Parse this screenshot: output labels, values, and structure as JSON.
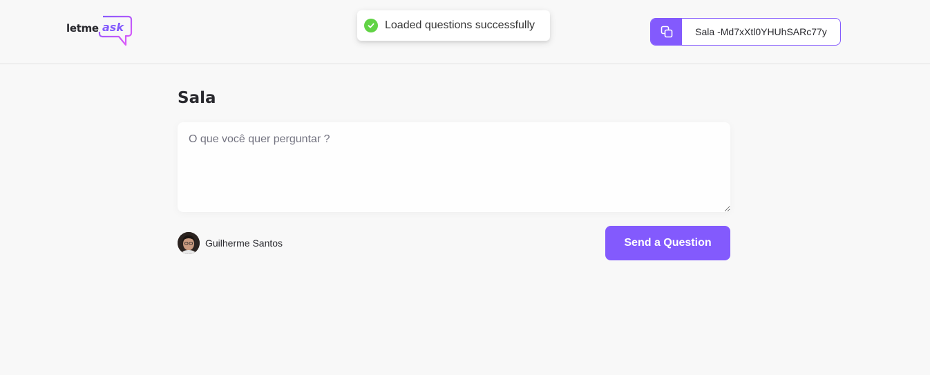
{
  "header": {
    "logo": {
      "text_letme": "letme",
      "text_ask": "ask",
      "icon": "speech-bubble-logo"
    },
    "room_code": {
      "icon": "copy-icon",
      "label": "Sala -Md7xXtl0YHUhSARc77y"
    }
  },
  "toast": {
    "icon": "check-circle-icon",
    "message": "Loaded questions successfully"
  },
  "main": {
    "title": "Sala",
    "question_input": {
      "placeholder": "O que você quer perguntar ?",
      "value": ""
    },
    "user": {
      "name": "Guilherme Santos"
    },
    "send_button": "Send a Question"
  },
  "colors": {
    "accent": "#835afd",
    "background": "#f8f8f8",
    "success": "#61d345",
    "text": "#29292e"
  }
}
